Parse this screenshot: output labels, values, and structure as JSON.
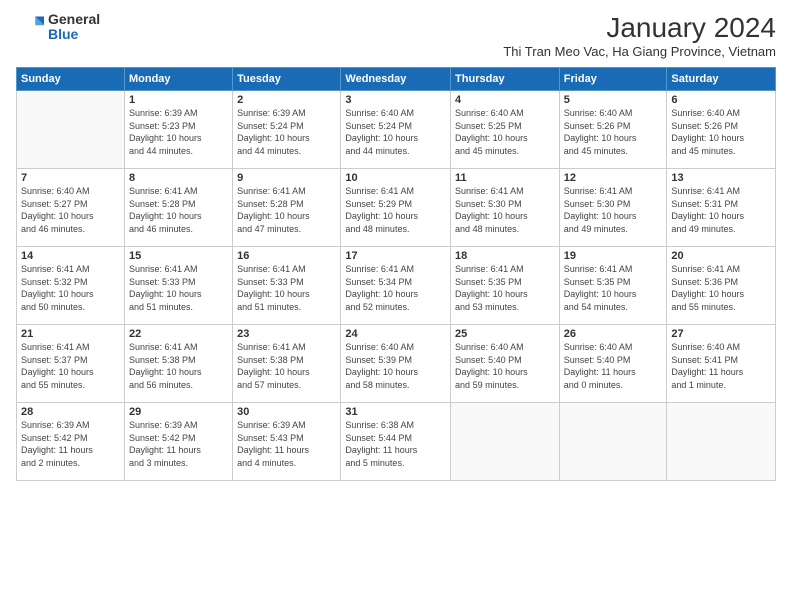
{
  "logo": {
    "general": "General",
    "blue": "Blue"
  },
  "title": "January 2024",
  "subtitle": "Thi Tran Meo Vac, Ha Giang Province, Vietnam",
  "days_header": [
    "Sunday",
    "Monday",
    "Tuesday",
    "Wednesday",
    "Thursday",
    "Friday",
    "Saturday"
  ],
  "weeks": [
    [
      {
        "day": "",
        "info": ""
      },
      {
        "day": "1",
        "info": "Sunrise: 6:39 AM\nSunset: 5:23 PM\nDaylight: 10 hours\nand 44 minutes."
      },
      {
        "day": "2",
        "info": "Sunrise: 6:39 AM\nSunset: 5:24 PM\nDaylight: 10 hours\nand 44 minutes."
      },
      {
        "day": "3",
        "info": "Sunrise: 6:40 AM\nSunset: 5:24 PM\nDaylight: 10 hours\nand 44 minutes."
      },
      {
        "day": "4",
        "info": "Sunrise: 6:40 AM\nSunset: 5:25 PM\nDaylight: 10 hours\nand 45 minutes."
      },
      {
        "day": "5",
        "info": "Sunrise: 6:40 AM\nSunset: 5:26 PM\nDaylight: 10 hours\nand 45 minutes."
      },
      {
        "day": "6",
        "info": "Sunrise: 6:40 AM\nSunset: 5:26 PM\nDaylight: 10 hours\nand 45 minutes."
      }
    ],
    [
      {
        "day": "7",
        "info": "Sunrise: 6:40 AM\nSunset: 5:27 PM\nDaylight: 10 hours\nand 46 minutes."
      },
      {
        "day": "8",
        "info": "Sunrise: 6:41 AM\nSunset: 5:28 PM\nDaylight: 10 hours\nand 46 minutes."
      },
      {
        "day": "9",
        "info": "Sunrise: 6:41 AM\nSunset: 5:28 PM\nDaylight: 10 hours\nand 47 minutes."
      },
      {
        "day": "10",
        "info": "Sunrise: 6:41 AM\nSunset: 5:29 PM\nDaylight: 10 hours\nand 48 minutes."
      },
      {
        "day": "11",
        "info": "Sunrise: 6:41 AM\nSunset: 5:30 PM\nDaylight: 10 hours\nand 48 minutes."
      },
      {
        "day": "12",
        "info": "Sunrise: 6:41 AM\nSunset: 5:30 PM\nDaylight: 10 hours\nand 49 minutes."
      },
      {
        "day": "13",
        "info": "Sunrise: 6:41 AM\nSunset: 5:31 PM\nDaylight: 10 hours\nand 49 minutes."
      }
    ],
    [
      {
        "day": "14",
        "info": "Sunrise: 6:41 AM\nSunset: 5:32 PM\nDaylight: 10 hours\nand 50 minutes."
      },
      {
        "day": "15",
        "info": "Sunrise: 6:41 AM\nSunset: 5:33 PM\nDaylight: 10 hours\nand 51 minutes."
      },
      {
        "day": "16",
        "info": "Sunrise: 6:41 AM\nSunset: 5:33 PM\nDaylight: 10 hours\nand 51 minutes."
      },
      {
        "day": "17",
        "info": "Sunrise: 6:41 AM\nSunset: 5:34 PM\nDaylight: 10 hours\nand 52 minutes."
      },
      {
        "day": "18",
        "info": "Sunrise: 6:41 AM\nSunset: 5:35 PM\nDaylight: 10 hours\nand 53 minutes."
      },
      {
        "day": "19",
        "info": "Sunrise: 6:41 AM\nSunset: 5:35 PM\nDaylight: 10 hours\nand 54 minutes."
      },
      {
        "day": "20",
        "info": "Sunrise: 6:41 AM\nSunset: 5:36 PM\nDaylight: 10 hours\nand 55 minutes."
      }
    ],
    [
      {
        "day": "21",
        "info": "Sunrise: 6:41 AM\nSunset: 5:37 PM\nDaylight: 10 hours\nand 55 minutes."
      },
      {
        "day": "22",
        "info": "Sunrise: 6:41 AM\nSunset: 5:38 PM\nDaylight: 10 hours\nand 56 minutes."
      },
      {
        "day": "23",
        "info": "Sunrise: 6:41 AM\nSunset: 5:38 PM\nDaylight: 10 hours\nand 57 minutes."
      },
      {
        "day": "24",
        "info": "Sunrise: 6:40 AM\nSunset: 5:39 PM\nDaylight: 10 hours\nand 58 minutes."
      },
      {
        "day": "25",
        "info": "Sunrise: 6:40 AM\nSunset: 5:40 PM\nDaylight: 10 hours\nand 59 minutes."
      },
      {
        "day": "26",
        "info": "Sunrise: 6:40 AM\nSunset: 5:40 PM\nDaylight: 11 hours\nand 0 minutes."
      },
      {
        "day": "27",
        "info": "Sunrise: 6:40 AM\nSunset: 5:41 PM\nDaylight: 11 hours\nand 1 minute."
      }
    ],
    [
      {
        "day": "28",
        "info": "Sunrise: 6:39 AM\nSunset: 5:42 PM\nDaylight: 11 hours\nand 2 minutes."
      },
      {
        "day": "29",
        "info": "Sunrise: 6:39 AM\nSunset: 5:42 PM\nDaylight: 11 hours\nand 3 minutes."
      },
      {
        "day": "30",
        "info": "Sunrise: 6:39 AM\nSunset: 5:43 PM\nDaylight: 11 hours\nand 4 minutes."
      },
      {
        "day": "31",
        "info": "Sunrise: 6:38 AM\nSunset: 5:44 PM\nDaylight: 11 hours\nand 5 minutes."
      },
      {
        "day": "",
        "info": ""
      },
      {
        "day": "",
        "info": ""
      },
      {
        "day": "",
        "info": ""
      }
    ]
  ]
}
